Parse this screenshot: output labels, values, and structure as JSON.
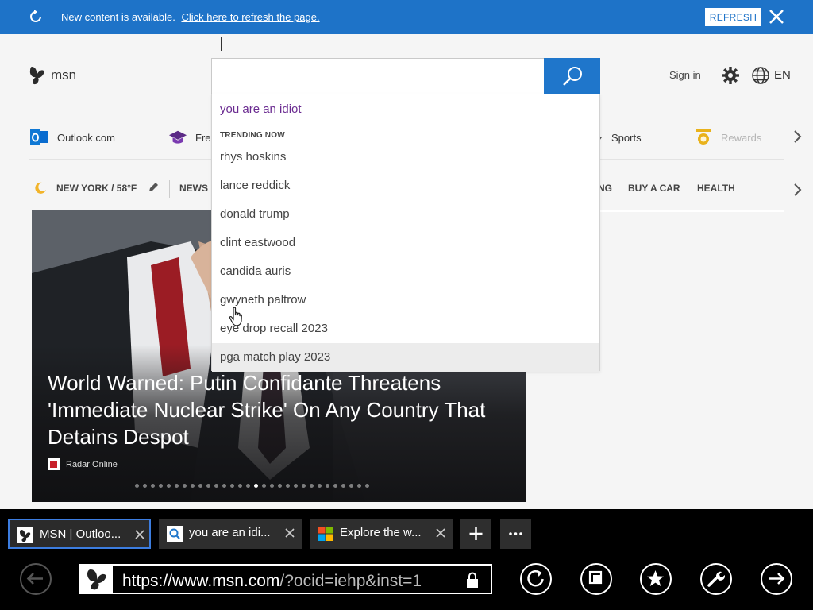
{
  "notification": {
    "message": "New content is available.",
    "link": "Click here to refresh the page.",
    "refresh_label": "REFRESH"
  },
  "header": {
    "logo_text": "msn",
    "sign_in": "Sign in",
    "language": "EN"
  },
  "quick_links": [
    {
      "label": "Outlook.com",
      "icon": "outlook-icon"
    },
    {
      "label": "Free",
      "icon": "graduation-cap-icon"
    },
    {
      "label": "Sports",
      "icon": "sports-icon"
    },
    {
      "label": "Rewards",
      "icon": "rewards-trophy-icon"
    }
  ],
  "nav": {
    "weather": "NEW YORK / 58°F",
    "items": [
      "NEWS",
      "NG",
      "BUY A CAR",
      "HEALTH"
    ]
  },
  "hero": {
    "headline": "World Warned: Putin Confidante Threatens 'Immediate Nuclear Strike' On Any Country That Detains Despot",
    "source": "Radar Online",
    "slide_count": 30,
    "active_slide": 15
  },
  "search": {
    "value": "",
    "history_item": "you are an idiot",
    "trending_header": "TRENDING NOW",
    "trending": [
      "rhys hoskins",
      "lance reddick",
      "donald trump",
      "clint eastwood",
      "candida auris",
      "gwyneth paltrow",
      "eye drop recall 2023",
      "pga match play 2023"
    ],
    "highlighted_index": 7
  },
  "browser": {
    "tabs": [
      {
        "title": "MSN | Outloo...",
        "active": true,
        "icon": "msn-butterfly-icon"
      },
      {
        "title": "you are an idi...",
        "active": false,
        "icon": "bing-search-icon"
      },
      {
        "title": "Explore the w...",
        "active": false,
        "icon": "windows-logo-icon"
      }
    ],
    "url_domain": "https://www.msn.com",
    "url_rest": "/?ocid=iehp&inst=1"
  },
  "colors": {
    "accent": "#1e73c8",
    "history_text": "#6b2c91",
    "chrome_bg": "#000000",
    "active_tab_border": "#3c7de0"
  }
}
